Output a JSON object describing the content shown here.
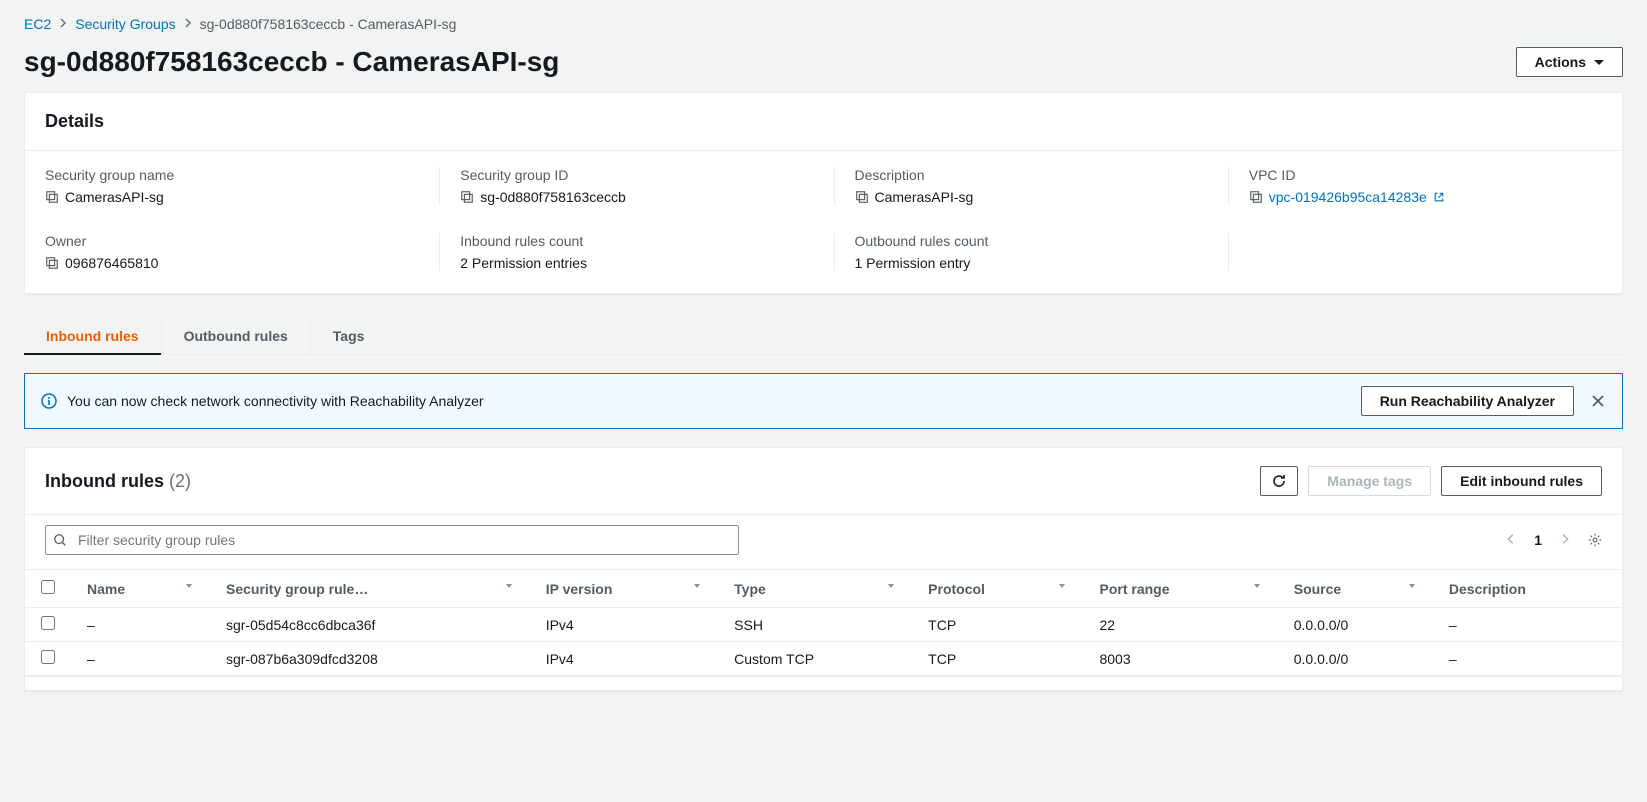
{
  "breadcrumb": {
    "root": "EC2",
    "parent": "Security Groups",
    "current": "sg-0d880f758163ceccb - CamerasAPI-sg"
  },
  "page_title": "sg-0d880f758163ceccb - CamerasAPI-sg",
  "actions_label": "Actions",
  "details": {
    "heading": "Details",
    "fields": {
      "sg_name_label": "Security group name",
      "sg_name_value": "CamerasAPI-sg",
      "sg_id_label": "Security group ID",
      "sg_id_value": "sg-0d880f758163ceccb",
      "desc_label": "Description",
      "desc_value": "CamerasAPI-sg",
      "vpc_label": "VPC ID",
      "vpc_value": "vpc-019426b95ca14283e",
      "owner_label": "Owner",
      "owner_value": "096876465810",
      "inbound_count_label": "Inbound rules count",
      "inbound_count_value": "2 Permission entries",
      "outbound_count_label": "Outbound rules count",
      "outbound_count_value": "1 Permission entry"
    }
  },
  "tabs": {
    "inbound": "Inbound rules",
    "outbound": "Outbound rules",
    "tags": "Tags"
  },
  "banner": {
    "text": "You can now check network connectivity with Reachability Analyzer",
    "button": "Run Reachability Analyzer"
  },
  "rules_panel": {
    "heading": "Inbound rules",
    "count": "(2)",
    "manage_tags": "Manage tags",
    "edit_rules": "Edit inbound rules",
    "filter_placeholder": "Filter security group rules",
    "page_number": "1"
  },
  "table": {
    "headers": {
      "name": "Name",
      "rule_id": "Security group rule…",
      "ip_version": "IP version",
      "type": "Type",
      "protocol": "Protocol",
      "port_range": "Port range",
      "source": "Source",
      "description": "Description"
    },
    "rows": [
      {
        "name": "–",
        "rule_id": "sgr-05d54c8cc6dbca36f",
        "ip_version": "IPv4",
        "type": "SSH",
        "protocol": "TCP",
        "port_range": "22",
        "source": "0.0.0.0/0",
        "description": "–"
      },
      {
        "name": "–",
        "rule_id": "sgr-087b6a309dfcd3208",
        "ip_version": "IPv4",
        "type": "Custom TCP",
        "protocol": "TCP",
        "port_range": "8003",
        "source": "0.0.0.0/0",
        "description": "–"
      }
    ]
  }
}
